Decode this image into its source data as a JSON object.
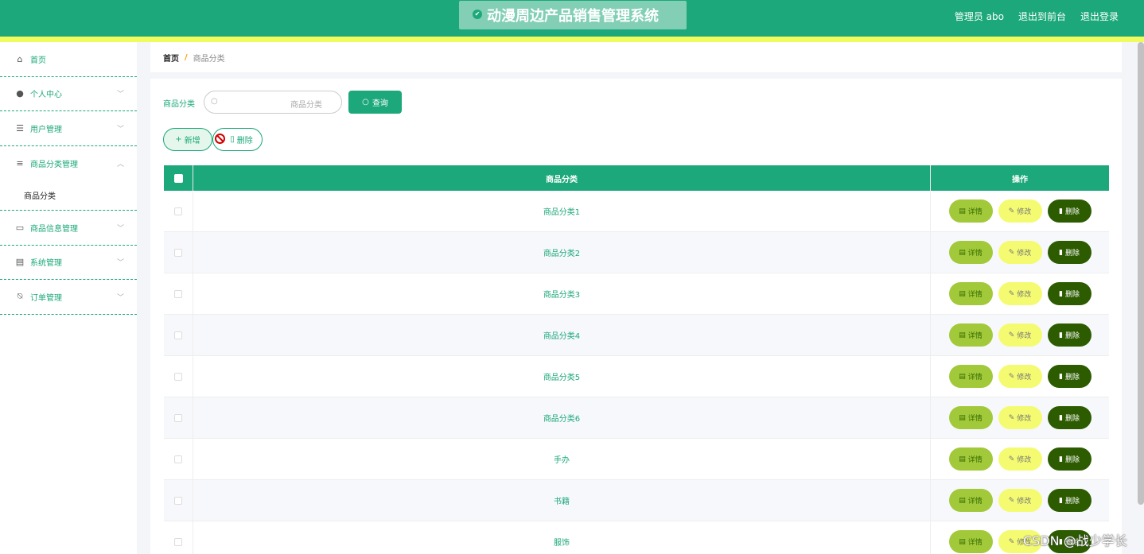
{
  "header": {
    "title": "动漫周边产品销售管理系统",
    "user_label": "管理员 abo",
    "to_front": "退出到前台",
    "logout": "退出登录"
  },
  "sidebar": {
    "items": [
      {
        "label": "首页",
        "icon": "home-icon"
      },
      {
        "label": "个人中心",
        "icon": "user-icon"
      },
      {
        "label": "用户管理",
        "icon": "sliders-icon"
      },
      {
        "label": "商品分类管理",
        "icon": "list-icon"
      },
      {
        "label": "商品分类",
        "icon": ""
      },
      {
        "label": "商品信息管理",
        "icon": "chat-icon"
      },
      {
        "label": "系统管理",
        "icon": "clipboard-icon"
      },
      {
        "label": "订单管理",
        "icon": "bell-off-icon"
      }
    ]
  },
  "breadcrumb": {
    "home": "首页",
    "separator": "/",
    "current": "商品分类"
  },
  "search": {
    "label": "商品分类",
    "placeholder": "商品分类",
    "button": "查询"
  },
  "actions": {
    "add": "新增",
    "delete": "删除"
  },
  "table": {
    "columns": [
      "商品分类",
      "操作"
    ],
    "rows": [
      "商品分类1",
      "商品分类2",
      "商品分类3",
      "商品分类4",
      "商品分类5",
      "商品分类6",
      "手办",
      "书籍",
      "服饰"
    ],
    "op_detail": "详情",
    "op_edit": "修改",
    "op_delete": "删除"
  },
  "watermark": "CSDN @战少学长",
  "colors": {
    "primary": "#1ca87a",
    "stripe": "#f0fb5e",
    "detail": "#a2c93a",
    "edit": "#f4fb71",
    "delete": "#2c5b00"
  }
}
